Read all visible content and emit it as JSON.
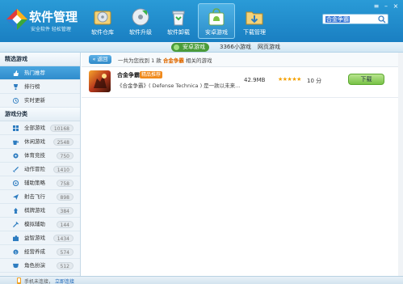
{
  "app": {
    "title": "软件管理",
    "subtitle": "安全软件 轻松管理"
  },
  "toolbar": [
    {
      "label": "软件仓库",
      "icon": "disc-box-icon"
    },
    {
      "label": "软件升级",
      "icon": "cd-upgrade-icon"
    },
    {
      "label": "软件卸载",
      "icon": "recycle-bin-icon"
    },
    {
      "label": "安卓游戏",
      "icon": "android-shopping-bag-icon",
      "active": true
    },
    {
      "label": "下载管理",
      "icon": "download-folder-icon"
    }
  ],
  "search": {
    "value": "合金争霸"
  },
  "subtabs": [
    {
      "label": "安卓游戏",
      "active": true
    },
    {
      "label": "3366小游戏"
    },
    {
      "label": "网页游戏"
    }
  ],
  "sidebar": {
    "section1_title": "精选游戏",
    "section1_items": [
      {
        "label": "热门推荐",
        "icon": "thumbs-up-icon",
        "active": true
      },
      {
        "label": "排行榜",
        "icon": "trophy-icon"
      },
      {
        "label": "实时更新",
        "icon": "clock-icon"
      }
    ],
    "section2_title": "游戏分类",
    "section2_items": [
      {
        "label": "全部游戏",
        "count": "10168",
        "icon": "grid-icon"
      },
      {
        "label": "休闲游戏",
        "count": "2548",
        "icon": "cup-icon"
      },
      {
        "label": "体育竞技",
        "count": "750",
        "icon": "ball-icon"
      },
      {
        "label": "动作冒险",
        "count": "1410",
        "icon": "sword-icon"
      },
      {
        "label": "辅助策略",
        "count": "758",
        "icon": "strategy-icon"
      },
      {
        "label": "射击飞行",
        "count": "898",
        "icon": "plane-icon"
      },
      {
        "label": "棋牌游戏",
        "count": "384",
        "icon": "chess-icon"
      },
      {
        "label": "模拟辅助",
        "count": "144",
        "icon": "tool-icon"
      },
      {
        "label": "益智游戏",
        "count": "1434",
        "icon": "puzzle-icon"
      },
      {
        "label": "经营养成",
        "count": "574",
        "icon": "coin-icon"
      },
      {
        "label": "角色扮演",
        "count": "512",
        "icon": "mask-icon"
      }
    ]
  },
  "main": {
    "back_label": "返回",
    "info_prefix": "一共为您找到 1 款",
    "info_keyword": "合金争霸",
    "info_suffix": "相关的游戏",
    "results": [
      {
        "name": "合金争霸",
        "tag": "精品推荐",
        "desc": "《合金争霸》( Defense Technica ) 是一款以未来...",
        "size": "42.9MB",
        "stars": "★★★★★",
        "score": "10 分",
        "download_label": "下载"
      }
    ]
  },
  "status": {
    "text": "手机未连接，",
    "link": "立即连接"
  }
}
